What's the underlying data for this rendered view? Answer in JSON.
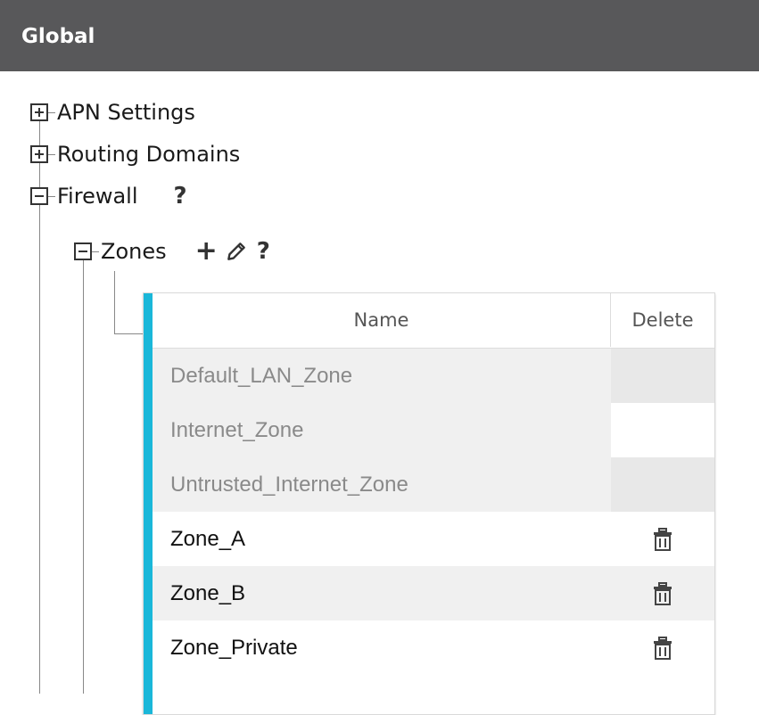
{
  "header": {
    "title": "Global"
  },
  "tree": {
    "apn_settings": {
      "label": "APN Settings",
      "expanded": false,
      "icon": "plus-toggle-icon"
    },
    "routing_domains": {
      "label": "Routing Domains",
      "expanded": false,
      "icon": "plus-toggle-icon"
    },
    "firewall": {
      "label": "Firewall",
      "expanded": true,
      "icon": "minus-toggle-icon",
      "help": "?",
      "zones": {
        "label": "Zones",
        "expanded": true,
        "icon": "minus-toggle-icon",
        "add": "+",
        "help": "?"
      }
    }
  },
  "zones_table": {
    "columns": {
      "name": "Name",
      "delete": "Delete"
    },
    "rows": [
      {
        "name": "Default_LAN_Zone",
        "deletable": false
      },
      {
        "name": "Internet_Zone",
        "deletable": false
      },
      {
        "name": "Untrusted_Internet_Zone",
        "deletable": false
      },
      {
        "name": "Zone_A",
        "deletable": true
      },
      {
        "name": "Zone_B",
        "deletable": true
      },
      {
        "name": "Zone_Private",
        "deletable": true
      }
    ]
  },
  "colors": {
    "header_bg": "#58585a",
    "accent": "#1ab7d9",
    "default_zone_text": "#8a8a8a",
    "custom_zone_text": "#111111"
  }
}
